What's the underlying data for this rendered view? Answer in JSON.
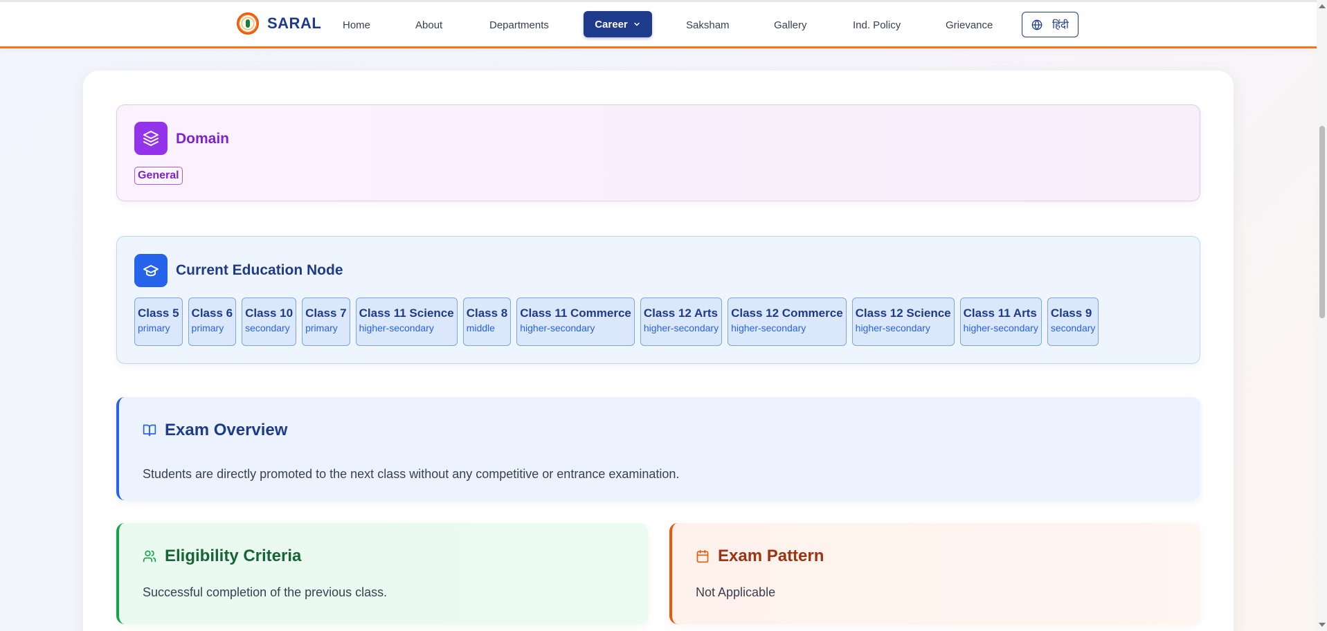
{
  "nav": {
    "brand": "SARAL",
    "items": [
      "Home",
      "About",
      "Departments",
      "Career",
      "Saksham",
      "Gallery",
      "Ind. Policy",
      "Grievance"
    ],
    "active": "Career",
    "language_label": "हिंदी"
  },
  "domain": {
    "title": "Domain",
    "tag": "General"
  },
  "education": {
    "title": "Current Education Node",
    "nodes": [
      {
        "name": "Class 5",
        "level": "primary"
      },
      {
        "name": "Class 6",
        "level": "primary"
      },
      {
        "name": "Class 10",
        "level": "secondary"
      },
      {
        "name": "Class 7",
        "level": "primary"
      },
      {
        "name": "Class 11 Science",
        "level": "higher-secondary"
      },
      {
        "name": "Class 8",
        "level": "middle"
      },
      {
        "name": "Class 11 Commerce",
        "level": "higher-secondary"
      },
      {
        "name": "Class 12 Arts",
        "level": "higher-secondary"
      },
      {
        "name": "Class 12 Commerce",
        "level": "higher-secondary"
      },
      {
        "name": "Class 12 Science",
        "level": "higher-secondary"
      },
      {
        "name": "Class 11 Arts",
        "level": "higher-secondary"
      },
      {
        "name": "Class 9",
        "level": "secondary"
      }
    ]
  },
  "overview": {
    "title": "Exam Overview",
    "text": "Students are directly promoted to the next class without any competitive or entrance examination."
  },
  "eligibility": {
    "title": "Eligibility Criteria",
    "text": "Successful completion of the previous class."
  },
  "pattern": {
    "title": "Exam Pattern",
    "text": "Not Applicable"
  },
  "icons": {
    "brand": "emblem-icon",
    "career_dropdown": "chevron-down-icon",
    "language": "globe-icon",
    "domain": "layers-icon",
    "education": "graduation-cap-icon",
    "overview": "book-open-icon",
    "eligibility": "users-icon",
    "pattern": "calendar-icon"
  },
  "colors": {
    "primary": "#1e3a8a",
    "accent": "#f97316",
    "domain": "#9333ea",
    "education": "#2563eb",
    "eligibility": "#16a34a",
    "pattern": "#ea580c"
  }
}
